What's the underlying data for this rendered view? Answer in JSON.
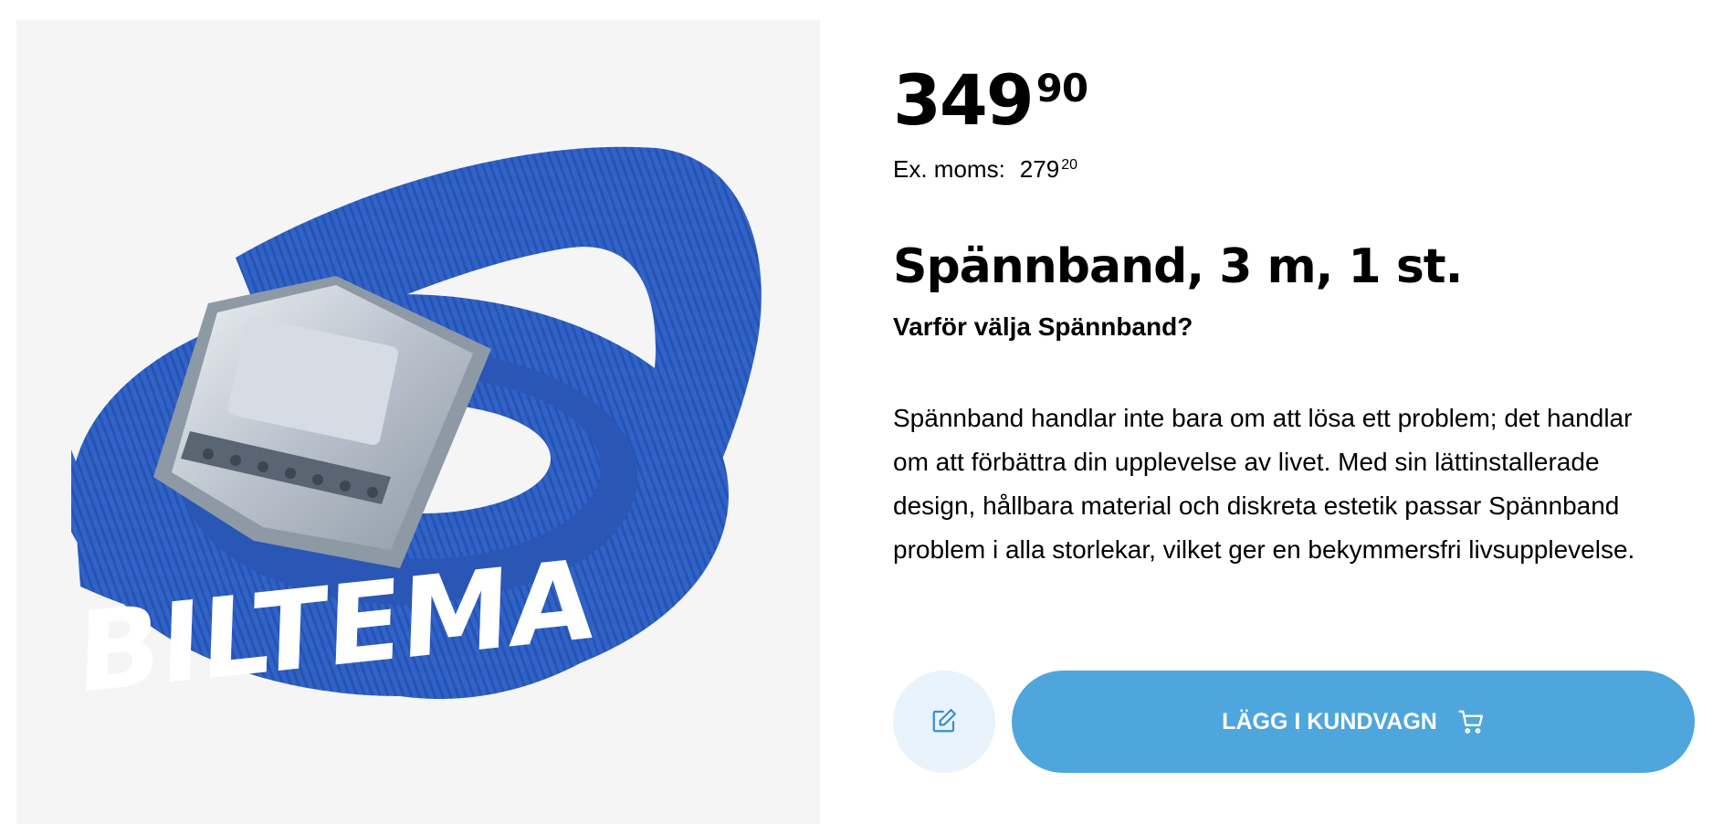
{
  "product_image": {
    "alt": "BILTEMA",
    "brand_print": "BILTEMA"
  },
  "price": {
    "main": "349",
    "cents": "90"
  },
  "ex_moms": {
    "label": "Ex. moms:",
    "main": "279",
    "cents": "20"
  },
  "title": "Spännband, 3 m, 1 st.",
  "subtitle": "Varför välja Spännband?",
  "description": "Spännband handlar inte bara om att lösa ett problem; det handlar om att förbättra din upplevelse av livet. Med sin lättinstallerade design, hållbara material och diskreta estetik passar Spännband problem i alla storlekar, vilket ger en bekymmersfri livsupplevelse.",
  "buttons": {
    "edit_icon": "edit-icon",
    "add_to_cart_label": "LÄGG I KUNDVAGN",
    "cart_icon": "cart-icon"
  },
  "colors": {
    "accent": "#4ea6dd",
    "edit_bg": "#e8f3fb",
    "strap_blue": "#2f63c9",
    "image_bg": "#f5f5f5"
  }
}
